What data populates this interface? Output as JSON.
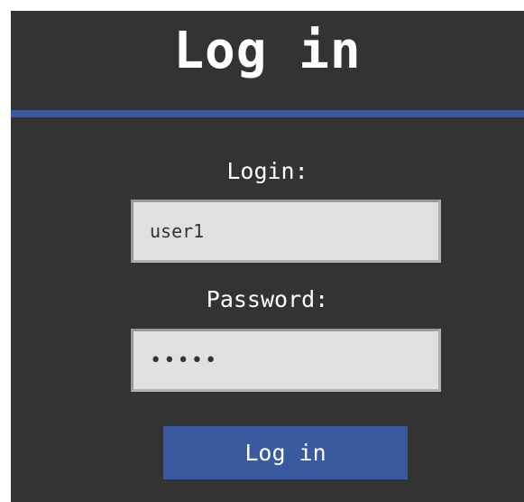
{
  "title": "Log in",
  "form": {
    "login_label": "Login:",
    "login_value": "user1",
    "password_label": "Password:",
    "password_value": "•••••",
    "submit_label": "Log in"
  },
  "colors": {
    "panel_background": "#333333",
    "accent": "#3a5aa0",
    "input_background": "#e0e0e0",
    "text": "#ffffff"
  }
}
